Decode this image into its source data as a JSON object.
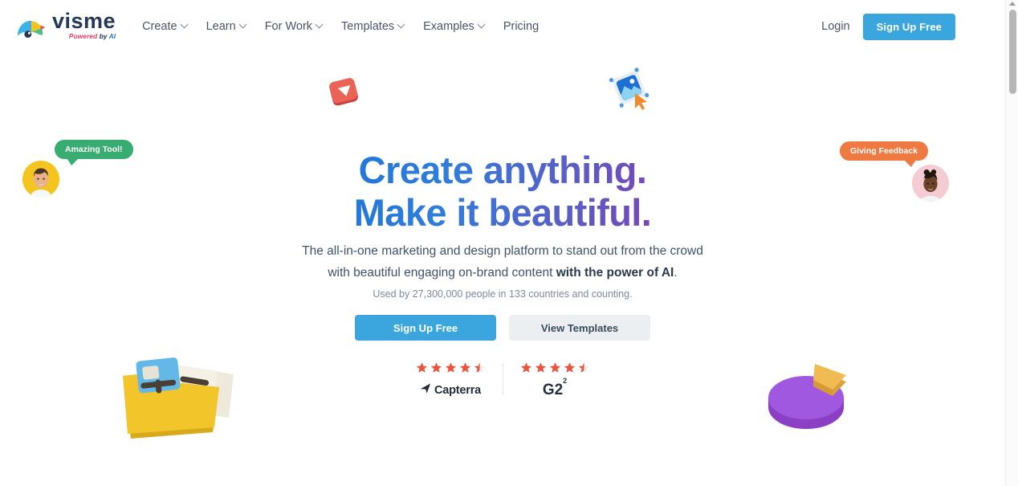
{
  "header": {
    "logo": {
      "word": "visme",
      "tagline_powered": "Powered",
      "tagline_by": " by ",
      "tagline_ai": "AI",
      "icon": "visme-fan-logo-icon"
    },
    "nav": [
      {
        "label": "Create",
        "has_dropdown": true
      },
      {
        "label": "Learn",
        "has_dropdown": true
      },
      {
        "label": "For Work",
        "has_dropdown": true
      },
      {
        "label": "Templates",
        "has_dropdown": true
      },
      {
        "label": "Examples",
        "has_dropdown": true
      },
      {
        "label": "Pricing",
        "has_dropdown": false
      }
    ],
    "login_label": "Login",
    "signup_label": "Sign Up Free",
    "signup_color": "#3aa6dd"
  },
  "hero": {
    "headline_line1": "Create anything.",
    "headline_line2": "Make it beautiful.",
    "headline_gradient_start": "#2b3f9e",
    "headline_gradient_mid": "#2f7ddc",
    "headline_gradient_end": "#d1226e",
    "subtitle_line1": "The all-in-one marketing and design platform to stand out from the crowd",
    "subtitle_line2_prefix": "with beautiful engaging on-brand content ",
    "subtitle_line2_bold": "with the power of AI",
    "subtitle_line2_suffix": ".",
    "usedby": "Used by 27,300,000 people in 133 countries and counting.",
    "cta_primary": "Sign Up Free",
    "cta_secondary": "View Templates"
  },
  "ratings": {
    "star_color": "#e8563f",
    "star_empty_color": "#e9eef2",
    "items": [
      {
        "brand": "Capterra",
        "icon": "capterra-paper-plane-icon",
        "stars": 4.5
      },
      {
        "brand": "G2",
        "superscript": "2",
        "icon": "g2-logo-icon",
        "stars": 4.5
      }
    ]
  },
  "testimonials": [
    {
      "text": "Amazing Tool!",
      "bubble_color": "#39ac72",
      "avatar": "avatar-man-yellow",
      "side": "left"
    },
    {
      "text": "Giving Feedback",
      "bubble_color": "#ee7941",
      "avatar": "avatar-woman-pink",
      "side": "right"
    }
  ],
  "decorations": [
    {
      "name": "video-play-3d-icon",
      "colors": [
        "#e8574f",
        "#ffffff"
      ]
    },
    {
      "name": "image-select-3d-icon",
      "colors": [
        "#1d6fd6",
        "#f08a2c"
      ]
    },
    {
      "name": "folder-documents-3d-icon",
      "colors": [
        "#f2c52a",
        "#63b8e8",
        "#f2eee3"
      ]
    },
    {
      "name": "pie-chart-3d-icon",
      "colors": [
        "#a158e0",
        "#f0bb53"
      ]
    }
  ],
  "scrollbar": {
    "position": "top",
    "thumb_height": 105
  }
}
